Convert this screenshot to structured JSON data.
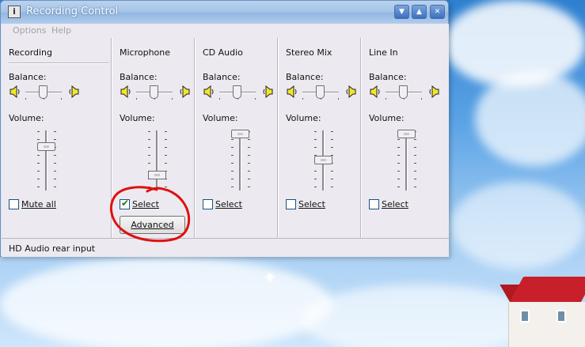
{
  "window": {
    "title": "Recording Control",
    "icon_glyph": "i",
    "menu": [
      "Options",
      "Help"
    ],
    "buttons": {
      "minimize": "▼",
      "maximize": "▲",
      "close": "✕"
    }
  },
  "labels": {
    "balance": "Balance:",
    "volume": "Volume:"
  },
  "columns": [
    {
      "title": "Recording",
      "checkbox_label": "Mute all",
      "checked": false,
      "volume_level": 0.75,
      "balance_level": 0.5
    },
    {
      "title": "Microphone",
      "checkbox_label": "Select",
      "checked": true,
      "volume_level": 0.2,
      "balance_level": 0.5,
      "advanced_label": "Advanced"
    },
    {
      "title": "CD Audio",
      "checkbox_label": "Select",
      "checked": false,
      "volume_level": 1.0,
      "balance_level": 0.5
    },
    {
      "title": "Stereo Mix",
      "checkbox_label": "Select",
      "checked": false,
      "volume_level": 0.5,
      "balance_level": 0.5
    },
    {
      "title": "Line In",
      "checkbox_label": "Select",
      "checked": false,
      "volume_level": 1.0,
      "balance_level": 0.5
    }
  ],
  "status": {
    "text": "HD Audio rear input"
  },
  "colors": {
    "annotation": "#e01010",
    "check": "#1d7e1d"
  }
}
